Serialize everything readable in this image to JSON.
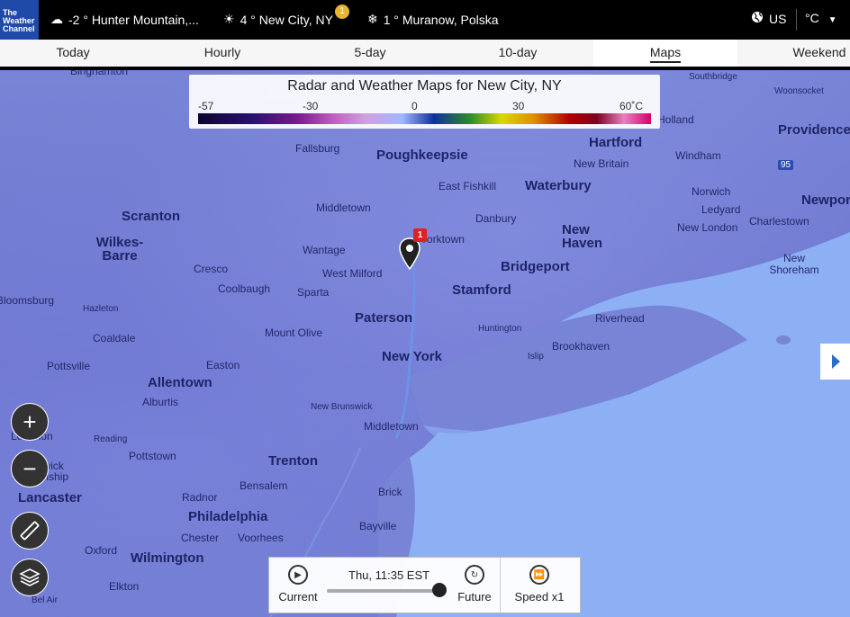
{
  "header": {
    "logo_text": [
      "The",
      "Weather",
      "Channel"
    ],
    "locations": [
      {
        "icon": "cloud-icon",
        "text": "-2 ° Hunter Mountain,..."
      },
      {
        "icon": "sun-icon",
        "text": "4 ° New City, NY"
      },
      {
        "icon": "snow-icon",
        "text": "1 ° Muranow, Polska"
      }
    ],
    "alert_count": "1",
    "region_label": "US",
    "unit_label": "°C"
  },
  "tabs": [
    "Today",
    "Hourly",
    "5-day",
    "10-day",
    "Maps",
    "Weekend"
  ],
  "active_tab": "Maps",
  "legend": {
    "title": "Radar and Weather Maps for New City, NY",
    "ticks": [
      "-57",
      "-30",
      "0",
      "30",
      "60˚C"
    ]
  },
  "map_labels": [
    {
      "text": "Binghamton",
      "size": "md"
    },
    {
      "text": "Southbridge",
      "size": "sm"
    },
    {
      "text": "Woonsocket",
      "size": "sm"
    },
    {
      "text": "Holland",
      "size": "sm"
    },
    {
      "text": "Providence",
      "size": "lg"
    },
    {
      "text": "Hartford",
      "size": "lg"
    },
    {
      "text": "New Britain",
      "size": "md"
    },
    {
      "text": "Windham",
      "size": "md"
    },
    {
      "text": "Fallsburg",
      "size": "md"
    },
    {
      "text": "Poughkeepsie",
      "size": "lg"
    },
    {
      "text": "East Fishkill",
      "size": "md"
    },
    {
      "text": "Waterbury",
      "size": "lg"
    },
    {
      "text": "Norwich",
      "size": "md"
    },
    {
      "text": "Ledyard",
      "size": "md"
    },
    {
      "text": "Newport",
      "size": "lg"
    },
    {
      "text": "Scranton",
      "size": "lg"
    },
    {
      "text": "Middletown",
      "size": "md"
    },
    {
      "text": "Danbury",
      "size": "md"
    },
    {
      "text": "New London",
      "size": "md"
    },
    {
      "text": "Charlestown",
      "size": "md"
    },
    {
      "text": "Wilkes-Barre",
      "size": "lg"
    },
    {
      "text": "Yorktown",
      "size": "md"
    },
    {
      "text": "New Haven",
      "size": "lg"
    },
    {
      "text": "Wantage",
      "size": "md"
    },
    {
      "text": "Cresco",
      "size": "md"
    },
    {
      "text": "West Milford",
      "size": "md"
    },
    {
      "text": "Bridgeport",
      "size": "lg"
    },
    {
      "text": "New Shoreham",
      "size": "md"
    },
    {
      "text": "Coolbaugh",
      "size": "md"
    },
    {
      "text": "Sparta",
      "size": "md"
    },
    {
      "text": "Stamford",
      "size": "lg"
    },
    {
      "text": "Bloomsburg",
      "size": "md"
    },
    {
      "text": "Hazleton",
      "size": "sm"
    },
    {
      "text": "Paterson",
      "size": "lg"
    },
    {
      "text": "Huntington",
      "size": "sm"
    },
    {
      "text": "Riverhead",
      "size": "md"
    },
    {
      "text": "Coaldale",
      "size": "md"
    },
    {
      "text": "Mount Olive",
      "size": "md"
    },
    {
      "text": "Brookhaven",
      "size": "md"
    },
    {
      "text": "Pottsville",
      "size": "md"
    },
    {
      "text": "Easton",
      "size": "md"
    },
    {
      "text": "New York",
      "size": "lg"
    },
    {
      "text": "Islip",
      "size": "sm"
    },
    {
      "text": "Allentown",
      "size": "lg"
    },
    {
      "text": "Alburtis",
      "size": "md"
    },
    {
      "text": "New Brunswick",
      "size": "sm"
    },
    {
      "text": "Middletown",
      "size": "md"
    },
    {
      "text": "Lebanon",
      "size": "md"
    },
    {
      "text": "Reading",
      "size": "sm"
    },
    {
      "text": "Pottstown",
      "size": "md"
    },
    {
      "text": "Warwick Township",
      "size": "md"
    },
    {
      "text": "Trenton",
      "size": "lg"
    },
    {
      "text": "Lancaster",
      "size": "lg"
    },
    {
      "text": "Bensalem",
      "size": "md"
    },
    {
      "text": "Brick",
      "size": "md"
    },
    {
      "text": "Radnor",
      "size": "md"
    },
    {
      "text": "Philadelphia",
      "size": "lg"
    },
    {
      "text": "Bayville",
      "size": "md"
    },
    {
      "text": "Chester",
      "size": "md"
    },
    {
      "text": "Voorhees",
      "size": "md"
    },
    {
      "text": "Oxford",
      "size": "md"
    },
    {
      "text": "Wilmington",
      "size": "lg"
    },
    {
      "text": "Elkton",
      "size": "md"
    },
    {
      "text": "Bel Air",
      "size": "sm"
    },
    {
      "text": "95",
      "size": "sm"
    }
  ],
  "pin_badge": "1",
  "controls": {
    "zoom_in": "+",
    "zoom_out": "−"
  },
  "player": {
    "current_label": "Current",
    "time_label": "Thu, 11:35 EST",
    "future_label": "Future",
    "speed_label": "Speed x1",
    "slider_position": 1.0
  }
}
